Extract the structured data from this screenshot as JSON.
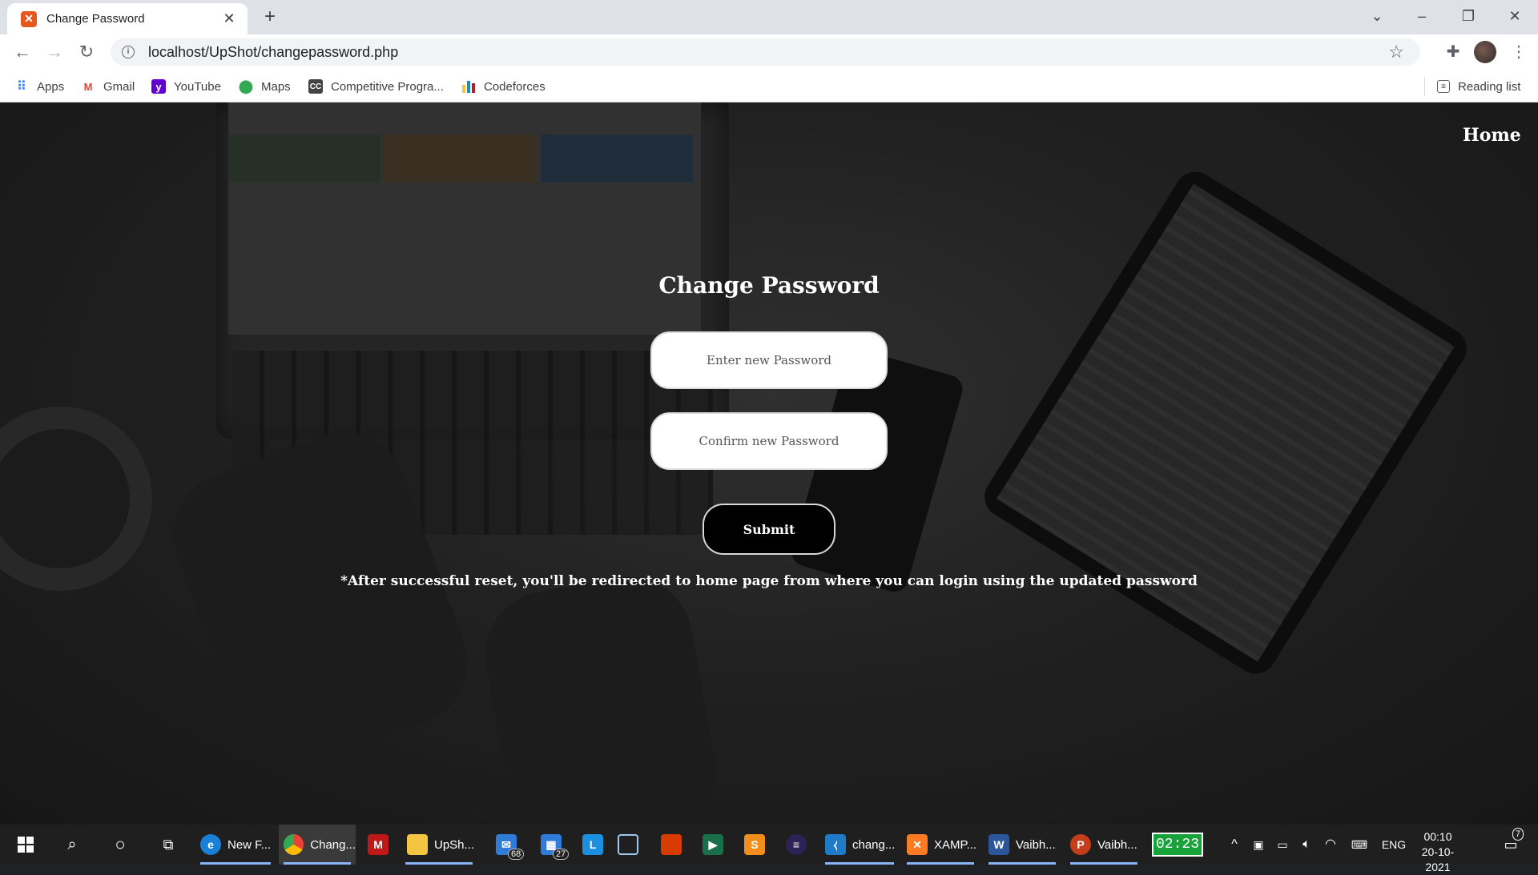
{
  "browser": {
    "tab_title": "Change Password",
    "tab_favicon": "XAMPP",
    "url": "localhost/UpShot/changepassword.php",
    "bookmarks": [
      {
        "label": "Apps",
        "icon": "apps-grid-icon"
      },
      {
        "label": "Gmail",
        "icon": "gmail-icon"
      },
      {
        "label": "YouTube",
        "icon": "youtube-icon"
      },
      {
        "label": "Maps",
        "icon": "maps-pin-icon"
      },
      {
        "label": "Competitive Progra...",
        "icon": "cc-icon"
      },
      {
        "label": "Codeforces",
        "icon": "codeforces-icon"
      }
    ],
    "reading_list": "Reading list"
  },
  "page": {
    "home_link": "Home",
    "title": "Change Password",
    "new_password_placeholder": "Enter new Password",
    "confirm_password_placeholder": "Confirm new Password",
    "submit_label": "Submit",
    "note": "*After successful reset, you'll be redirected to home page from where you can login using the updated password"
  },
  "taskbar": {
    "apps": [
      {
        "label": "New F...",
        "icon": "edge-icon"
      },
      {
        "label": "Chang...",
        "icon": "chrome-icon",
        "active": true
      },
      {
        "label": "",
        "icon": "mcafee-icon"
      },
      {
        "label": "UpSh...",
        "icon": "folder-icon"
      },
      {
        "label": "",
        "icon": "mail-icon",
        "badge": "68"
      },
      {
        "label": "",
        "icon": "calendar-icon",
        "badge": "27"
      },
      {
        "label": "",
        "icon": "l-app-icon"
      },
      {
        "label": "",
        "icon": "virtualbox-icon"
      },
      {
        "label": "",
        "icon": "office-icon"
      },
      {
        "label": "",
        "icon": "media-icon"
      },
      {
        "label": "",
        "icon": "sublime-icon"
      },
      {
        "label": "",
        "icon": "eclipse-icon"
      },
      {
        "label": "chang...",
        "icon": "vscode-icon"
      },
      {
        "label": "XAMP...",
        "icon": "xampp-icon"
      },
      {
        "label": "Vaibh...",
        "icon": "word-icon"
      },
      {
        "label": "Vaibh...",
        "icon": "powerpoint-icon"
      }
    ],
    "timer": "02:23",
    "language": "ENG",
    "time": "00:10",
    "date": "20-10-2021",
    "notifications": "7"
  }
}
